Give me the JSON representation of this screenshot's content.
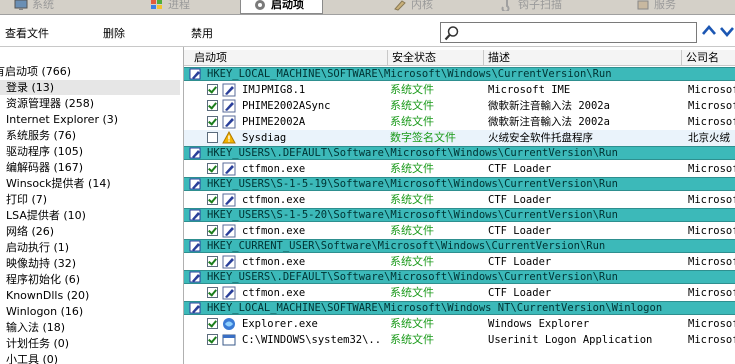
{
  "tabs": [
    {
      "label": "系统",
      "icon": "monitor-icon",
      "active": false
    },
    {
      "label": "进程",
      "icon": "windows-icon",
      "active": false
    },
    {
      "label": "启动项",
      "icon": "gear-icon",
      "active": true
    },
    {
      "label": "内核",
      "icon": "pencil-icon",
      "active": false
    },
    {
      "label": "钩子扫描",
      "icon": "hook-icon",
      "active": false
    },
    {
      "label": "服务",
      "icon": "service-icon",
      "active": false
    }
  ],
  "toolbar": {
    "view_file": "查看文件",
    "delete": "删除",
    "disable": "禁用",
    "search_value": "",
    "search_icon": "search-icon"
  },
  "sidebar": {
    "items": [
      {
        "label": "有启动项 (766)",
        "selected": false
      },
      {
        "label": "登录 (13)",
        "selected": true
      },
      {
        "label": "资源管理器 (258)",
        "selected": false
      },
      {
        "label": "Internet Explorer (3)",
        "selected": false
      },
      {
        "label": "系统服务 (76)",
        "selected": false
      },
      {
        "label": "驱动程序 (105)",
        "selected": false
      },
      {
        "label": "编解码器 (167)",
        "selected": false
      },
      {
        "label": "Winsock提供者 (14)",
        "selected": false
      },
      {
        "label": "打印 (7)",
        "selected": false
      },
      {
        "label": "LSA提供者 (10)",
        "selected": false
      },
      {
        "label": "网络 (26)",
        "selected": false
      },
      {
        "label": "启动执行 (1)",
        "selected": false
      },
      {
        "label": "映像劫持 (32)",
        "selected": false
      },
      {
        "label": "程序初始化 (6)",
        "selected": false
      },
      {
        "label": "KnownDlls (20)",
        "selected": false
      },
      {
        "label": "Winlogon (16)",
        "selected": false
      },
      {
        "label": "输入法 (18)",
        "selected": false
      },
      {
        "label": "计划任务 (0)",
        "selected": false
      },
      {
        "label": "小工具 (0)",
        "selected": false
      }
    ]
  },
  "grid": {
    "headers": {
      "name": "启动项",
      "security": "安全状态",
      "desc": "描述",
      "company": "公司名"
    },
    "groups": [
      {
        "key": "HKEY_LOCAL_MACHINE\\SOFTWARE\\Microsoft\\Windows\\CurrentVersion\\Run",
        "rows": [
          {
            "checked": true,
            "icon": "ime-icon",
            "name": "IMJPMIG8.1",
            "security": "系统文件",
            "desc": "Microsoft IME",
            "company": "Microsof",
            "highlight": false
          },
          {
            "checked": true,
            "icon": "ime-icon",
            "name": "PHIME2002ASync",
            "security": "系统文件",
            "desc": "微軟新注音輸入法 2002a",
            "company": "Microsof",
            "highlight": false
          },
          {
            "checked": true,
            "icon": "ime-icon",
            "name": "PHIME2002A",
            "security": "系统文件",
            "desc": "微軟新注音輸入法 2002a",
            "company": "Microsof",
            "highlight": false
          },
          {
            "checked": false,
            "icon": "warning-icon",
            "name": "Sysdiag",
            "security": "数字签名文件",
            "desc": "火绒安全软件托盘程序",
            "company": "北京火绒",
            "highlight": true
          }
        ]
      },
      {
        "key": "HKEY_USERS\\.DEFAULT\\Software\\Microsoft\\Windows\\CurrentVersion\\Run",
        "rows": [
          {
            "checked": true,
            "icon": "ime-icon",
            "name": "ctfmon.exe",
            "security": "系统文件",
            "desc": "CTF Loader",
            "company": "Microsof",
            "highlight": false
          }
        ]
      },
      {
        "key": "HKEY_USERS\\S-1-5-19\\Software\\Microsoft\\Windows\\CurrentVersion\\Run",
        "rows": [
          {
            "checked": true,
            "icon": "ime-icon",
            "name": "ctfmon.exe",
            "security": "系统文件",
            "desc": "CTF Loader",
            "company": "Microsof",
            "highlight": false
          }
        ]
      },
      {
        "key": "HKEY_USERS\\S-1-5-20\\Software\\Microsoft\\Windows\\CurrentVersion\\Run",
        "rows": [
          {
            "checked": true,
            "icon": "ime-icon",
            "name": "ctfmon.exe",
            "security": "系统文件",
            "desc": "CTF Loader",
            "company": "Microsof",
            "highlight": false
          }
        ]
      },
      {
        "key": "HKEY_CURRENT_USER\\Software\\Microsoft\\Windows\\CurrentVersion\\Run",
        "rows": [
          {
            "checked": true,
            "icon": "ime-icon",
            "name": "ctfmon.exe",
            "security": "系统文件",
            "desc": "CTF Loader",
            "company": "Microsof",
            "highlight": false
          }
        ]
      },
      {
        "key": "HKEY_USERS\\.DEFAULT\\Software\\Microsoft\\Windows\\CurrentVersion\\Run",
        "rows": [
          {
            "checked": true,
            "icon": "ime-icon",
            "name": "ctfmon.exe",
            "security": "系统文件",
            "desc": "CTF Loader",
            "company": "Microsof",
            "highlight": false
          }
        ]
      },
      {
        "key": "HKEY_LOCAL_MACHINE\\SOFTWARE\\Microsoft\\Windows NT\\CurrentVersion\\Winlogon",
        "rows": [
          {
            "checked": true,
            "icon": "explorer-icon",
            "name": "Explorer.exe",
            "security": "系统文件",
            "desc": "Windows Explorer",
            "company": "Microsof",
            "highlight": false
          },
          {
            "checked": true,
            "icon": "window-icon",
            "name": "C:\\WINDOWS\\system32\\...",
            "security": "系统文件",
            "desc": "Userinit Logon Application",
            "company": "Microsof",
            "highlight": false
          }
        ]
      }
    ]
  },
  "colors": {
    "group_bg": "#3cb9b9",
    "secure_text": "#1a9a1a",
    "nav_arrow": "#1c57b3"
  }
}
